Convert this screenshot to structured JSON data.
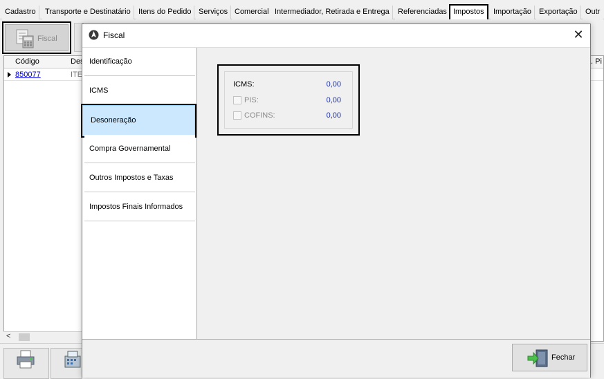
{
  "top_tabs": [
    {
      "label": "Cadastro"
    },
    {
      "label": "Transporte e Destinatário"
    },
    {
      "label": "Itens do Pedido"
    },
    {
      "label": "Serviços"
    },
    {
      "label": "Comercial"
    },
    {
      "label": "Intermediador, Retirada e Entrega"
    },
    {
      "label": "Referenciadas"
    },
    {
      "label": "Impostos"
    },
    {
      "label": "Importação"
    },
    {
      "label": "Exportação"
    },
    {
      "label": "Outr"
    }
  ],
  "toolbar": {
    "fiscal_label": "Fiscal"
  },
  "grid": {
    "columns": [
      "Código",
      "Des",
      ". Pi"
    ],
    "rows": [
      {
        "code": "850077",
        "description": "ITE"
      }
    ],
    "scroll_left": "<"
  },
  "dialog": {
    "title": "Fiscal",
    "close_glyph": "✕",
    "nav_items": [
      {
        "label": "Identificação"
      },
      {
        "label": "ICMS"
      },
      {
        "label": "Desoneração"
      },
      {
        "label": "Compra Governamental"
      },
      {
        "label": "Outros Impostos e Taxas"
      },
      {
        "label": "Impostos Finais Informados"
      }
    ],
    "active_item": "Desoneração",
    "tax_rows": [
      {
        "label": "ICMS:",
        "value": "0,00"
      },
      {
        "label": "PIS:",
        "value": "0,00",
        "checked": false
      },
      {
        "label": "COFINS:",
        "value": "0,00",
        "checked": false
      }
    ],
    "close_button_label": "Fechar"
  },
  "colors": {
    "selection": "#cce8ff",
    "value_text": "#1a2da8",
    "link": "#0000ee"
  },
  "icons": [
    "fiscal-calculator-icon",
    "printer-icon",
    "cash-register-icon",
    "fiscal-app-icon",
    "close-icon",
    "exit-door-icon",
    "checkbox"
  ]
}
